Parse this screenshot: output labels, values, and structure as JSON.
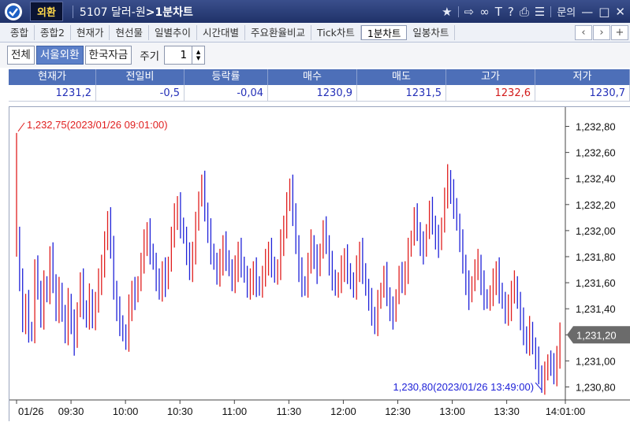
{
  "titlebar": {
    "badge": "외환",
    "code": "5107",
    "name": "달러-원",
    "screen": ">1분차트",
    "inquiry": "문의"
  },
  "tabs": [
    "종합",
    "종합2",
    "현재가",
    "현선물",
    "일별추이",
    "시간대별",
    "주요환율비교",
    "Tick차트",
    "1분차트",
    "일봉차트"
  ],
  "active_tab": "1분차트",
  "filters": {
    "buttons": [
      "전체",
      "서울외환",
      "한국자금"
    ],
    "active": "서울외환",
    "period_label": "주기",
    "period_value": "1"
  },
  "quote": {
    "headers": [
      "현재가",
      "전일비",
      "등락률",
      "매수",
      "매도",
      "고가",
      "저가"
    ],
    "values": [
      "1231,2",
      "-0,5",
      "-0,04",
      "1230,9",
      "1231,5",
      "1232,6",
      "1230,7"
    ]
  },
  "colors": {
    "up": "#e01f1f",
    "down": "#1f22d8",
    "header": "#4d6fb8",
    "titlebar": "#1f3168"
  },
  "chart_data": {
    "type": "candlestick",
    "ylim": [
      1230.7,
      1232.9
    ],
    "y_ticks": [
      "1,232,80",
      "1,232,60",
      "1,232,40",
      "1,232,20",
      "1,232,00",
      "1,231,80",
      "1,231,60",
      "1,231,40",
      "1,231,20",
      "1,231,00",
      "1,230,80"
    ],
    "x_ticks": [
      "01/26",
      "09:30",
      "10:00",
      "10:30",
      "11:00",
      "11:30",
      "12:00",
      "12:30",
      "13:00",
      "13:30",
      "14:01:00"
    ],
    "current_price_label": "1,231,20",
    "current_price": 1231.2,
    "max_annotation": "1,232,75(2023/01/26 09:01:00)",
    "max_value": 1232.75,
    "min_annotation": "1,230,80(2023/01/26 13:49:00)",
    "min_value": 1230.8,
    "start_time": "09:00",
    "end_time": "14:01",
    "close": [
      1231.95,
      1231.6,
      1231.3,
      1231.45,
      1231.25,
      1231.2,
      1231.7,
      1231.55,
      1231.35,
      1231.6,
      1231.5,
      1231.8,
      1231.6,
      1231.4,
      1231.55,
      1231.35,
      1231.2,
      1231.45,
      1231.3,
      1231.15,
      1231.4,
      1231.6,
      1231.4,
      1231.35,
      1231.5,
      1231.3,
      1231.45,
      1231.6,
      1231.75,
      1231.9,
      1232.1,
      1231.85,
      1231.55,
      1231.4,
      1231.3,
      1231.2,
      1231.15,
      1231.4,
      1231.55,
      1231.5,
      1231.6,
      1231.75,
      1231.9,
      1232.0,
      1231.85,
      1231.75,
      1231.6,
      1231.55,
      1231.7,
      1231.6,
      1231.75,
      1231.95,
      1232.1,
      1232.2,
      1232.05,
      1231.95,
      1231.8,
      1231.7,
      1231.85,
      1232.05,
      1232.25,
      1232.35,
      1232.15,
      1232.0,
      1231.85,
      1231.75,
      1231.65,
      1231.75,
      1231.9,
      1231.8,
      1231.7,
      1231.6,
      1231.7,
      1231.85,
      1231.75,
      1231.65,
      1231.55,
      1231.6,
      1231.7,
      1231.6,
      1231.55,
      1231.65,
      1231.75,
      1231.85,
      1231.75,
      1231.65,
      1231.7,
      1231.9,
      1232.05,
      1232.2,
      1232.35,
      1232.1,
      1231.9,
      1231.7,
      1231.6,
      1231.55,
      1231.75,
      1231.9,
      1231.8,
      1231.7,
      1231.85,
      1232.0,
      1231.9,
      1231.75,
      1231.65,
      1231.55,
      1231.6,
      1231.7,
      1231.8,
      1231.7,
      1231.6,
      1231.55,
      1231.7,
      1231.85,
      1231.7,
      1231.55,
      1231.45,
      1231.35,
      1231.3,
      1231.45,
      1231.55,
      1231.65,
      1231.5,
      1231.4,
      1231.35,
      1231.5,
      1231.65,
      1231.6,
      1231.7,
      1231.85,
      1231.95,
      1232.1,
      1232.0,
      1231.9,
      1231.85,
      1232.0,
      1232.15,
      1232.05,
      1231.95,
      1231.9,
      1232.05,
      1232.25,
      1232.4,
      1232.3,
      1232.2,
      1232.05,
      1231.9,
      1231.75,
      1231.6,
      1231.5,
      1231.6,
      1231.7,
      1231.75,
      1231.6,
      1231.5,
      1231.45,
      1231.5,
      1231.6,
      1231.7,
      1231.55,
      1231.45,
      1231.35,
      1231.4,
      1231.55,
      1231.6,
      1231.45,
      1231.3,
      1231.2,
      1231.15,
      1231.25,
      1231.1,
      1231.0,
      1230.9,
      1230.85,
      1230.9,
      1231.0,
      1230.95,
      1230.9,
      1231.05,
      1231.2
    ]
  }
}
